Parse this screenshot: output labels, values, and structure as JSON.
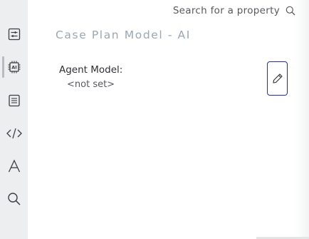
{
  "search": {
    "placeholder": "Search for a property"
  },
  "panel": {
    "title": "Case Plan Model - AI"
  },
  "property": {
    "label": "Agent Model:",
    "value": "<not set>"
  },
  "sidebar": {
    "items": [
      {
        "icon": "sliders-icon",
        "active": false
      },
      {
        "icon": "ai-chip-icon",
        "active": true
      },
      {
        "icon": "document-icon",
        "active": false
      },
      {
        "icon": "code-icon",
        "active": false
      },
      {
        "icon": "font-icon",
        "active": false
      },
      {
        "icon": "search-icon",
        "active": false
      }
    ]
  },
  "colors": {
    "sidebar_bg": "#eceeef",
    "icon": "#3a3f44",
    "title": "#9aa7b2",
    "edit_border": "#1f2fa3"
  }
}
